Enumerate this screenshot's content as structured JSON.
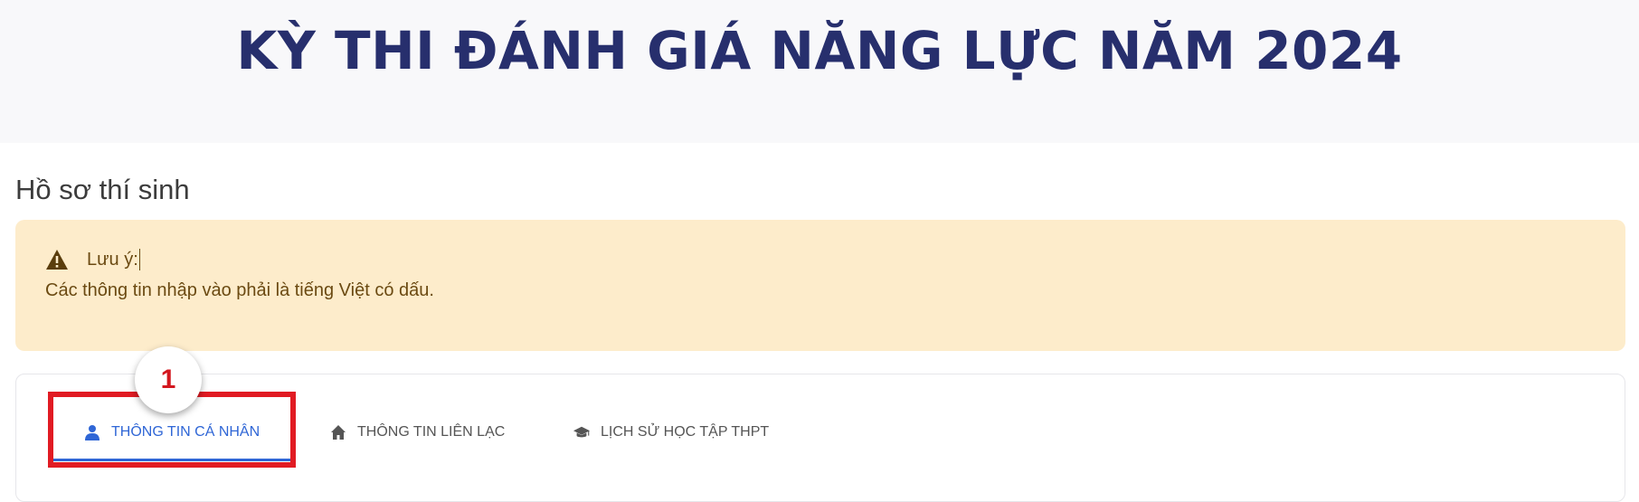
{
  "header": {
    "title": "KỲ THI ĐÁNH GIÁ NĂNG LỰC NĂM 2024"
  },
  "page": {
    "heading": "Hồ sơ thí sinh"
  },
  "notice": {
    "label": "Lưu ý:",
    "message": "Các thông tin nhập vào phải là tiếng Việt có dấu.",
    "icon": "warning-icon"
  },
  "tabs": [
    {
      "label": "THÔNG TIN CÁ NHÂN",
      "icon": "user-icon",
      "active": true
    },
    {
      "label": "THÔNG TIN LIÊN LẠC",
      "icon": "home-icon",
      "active": false
    },
    {
      "label": "LỊCH SỬ HỌC TẬP THPT",
      "icon": "graduation-cap-icon",
      "active": false
    }
  ],
  "annotation": {
    "step_number": "1"
  },
  "colors": {
    "title": "#272f6d",
    "accent": "#2f66d6",
    "alert_bg": "#fdeccb",
    "highlight": "#e11b23"
  }
}
